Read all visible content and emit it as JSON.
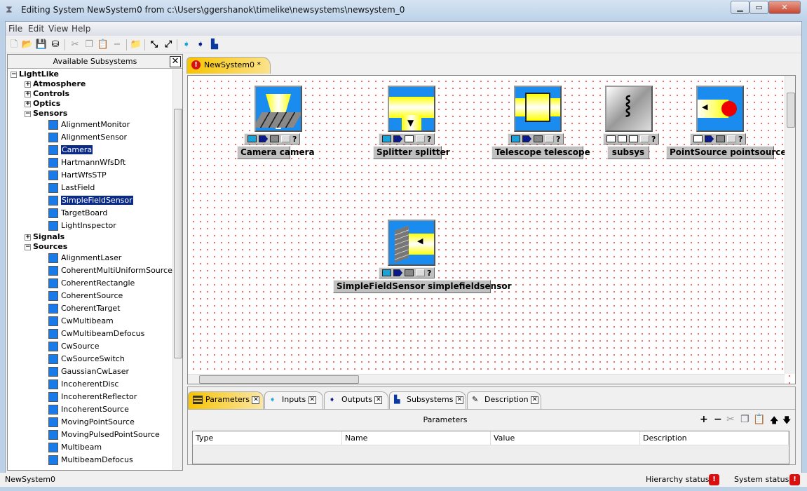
{
  "window": {
    "title": "Editing System NewSystem0 from c:\\Users\\ggershanok\\timelike\\newsystems\\newsystem_0",
    "minimize": "▁",
    "maximize": "▭",
    "close": "✕"
  },
  "menu": [
    "File",
    "Edit",
    "View",
    "Help"
  ],
  "toolbar": [
    "new-icon",
    "open-icon",
    "save-icon",
    "save-all-icon",
    "cut-icon",
    "copy-icon",
    "paste-icon",
    "remove-icon",
    "import-icon",
    "collapse-icon",
    "expand-icon",
    "add-input-icon",
    "add-output-icon",
    "add-subsystem-icon"
  ],
  "left_panel": {
    "title": "Available Subsystems",
    "close": "✕"
  },
  "tree": [
    {
      "label": "LightLike",
      "kind": "root"
    },
    {
      "label": "Atmosphere",
      "kind": "group",
      "exp": "+"
    },
    {
      "label": "Controls",
      "kind": "group",
      "exp": "+"
    },
    {
      "label": "Optics",
      "kind": "group",
      "exp": "+"
    },
    {
      "label": "Sensors",
      "kind": "group",
      "exp": "−"
    },
    {
      "label": "AlignmentMonitor",
      "kind": "leaf"
    },
    {
      "label": "AlignmentSensor",
      "kind": "leaf"
    },
    {
      "label": "Camera",
      "kind": "leaf",
      "selected": true
    },
    {
      "label": "HartmannWfsDft",
      "kind": "leaf"
    },
    {
      "label": "HartWfsSTP",
      "kind": "leaf"
    },
    {
      "label": "LastField",
      "kind": "leaf"
    },
    {
      "label": "SimpleFieldSensor",
      "kind": "leaf",
      "selected": true
    },
    {
      "label": "TargetBoard",
      "kind": "leaf"
    },
    {
      "label": "LightInspector",
      "kind": "leaf"
    },
    {
      "label": "Signals",
      "kind": "group",
      "exp": "+"
    },
    {
      "label": "Sources",
      "kind": "group",
      "exp": "−"
    },
    {
      "label": "AlignmentLaser",
      "kind": "leaf"
    },
    {
      "label": "CoherentMultiUniformSource",
      "kind": "leaf"
    },
    {
      "label": "CoherentRectangle",
      "kind": "leaf"
    },
    {
      "label": "CoherentSource",
      "kind": "leaf"
    },
    {
      "label": "CoherentTarget",
      "kind": "leaf"
    },
    {
      "label": "CwMultibeam",
      "kind": "leaf"
    },
    {
      "label": "CwMultibeamDefocus",
      "kind": "leaf"
    },
    {
      "label": "CwSource",
      "kind": "leaf"
    },
    {
      "label": "CwSourceSwitch",
      "kind": "leaf"
    },
    {
      "label": "GaussianCwLaser",
      "kind": "leaf"
    },
    {
      "label": "IncoherentDisc",
      "kind": "leaf"
    },
    {
      "label": "IncoherentReflector",
      "kind": "leaf"
    },
    {
      "label": "IncoherentSource",
      "kind": "leaf"
    },
    {
      "label": "MovingPointSource",
      "kind": "leaf"
    },
    {
      "label": "MovingPulsedPointSource",
      "kind": "leaf"
    },
    {
      "label": "Multibeam",
      "kind": "leaf"
    },
    {
      "label": "MultibeamDefocus",
      "kind": "leaf"
    }
  ],
  "editor_tab": {
    "label": "NewSystem0 *",
    "status_icon": "error-icon"
  },
  "blocks": [
    {
      "label": "Camera camera",
      "icon": "camera-icon",
      "ports": [
        "in",
        "out",
        "grey",
        "light"
      ]
    },
    {
      "label": "Splitter splitter",
      "icon": "splitter-icon",
      "ports": [
        "in",
        "out",
        "white",
        "light"
      ]
    },
    {
      "label": "Telescope telescope",
      "icon": "telescope-icon",
      "ports": [
        "in",
        "out",
        "grey",
        "light"
      ]
    },
    {
      "label": "subsys",
      "icon": "subsystem-icon",
      "ports": [
        "in-outline",
        "out-outline",
        "white",
        "light"
      ]
    },
    {
      "label": "PointSource pointsource",
      "icon": "point-source-icon",
      "ports": [
        "in-outline",
        "out",
        "grey",
        "light"
      ]
    },
    {
      "label": "SimpleFieldSensor simplefieldsensor",
      "icon": "simple-field-sensor-icon",
      "ports": [
        "in",
        "out",
        "grey",
        "light"
      ]
    }
  ],
  "help_glyph": "?",
  "bottom_tabs": [
    {
      "label": "Parameters",
      "active": true
    },
    {
      "label": "Inputs"
    },
    {
      "label": "Outputs"
    },
    {
      "label": "Subsystems"
    },
    {
      "label": "Description"
    }
  ],
  "parameters": {
    "title": "Parameters",
    "actions": [
      "+",
      "−",
      "cut-icon",
      "copy-icon",
      "paste-icon",
      "move-up-icon",
      "move-down-icon"
    ],
    "columns": [
      "Type",
      "Name",
      "Value",
      "Description"
    ],
    "rows": []
  },
  "status": {
    "left": "NewSystem0",
    "hierarchy_label": "Hierarchy status:",
    "system_label": "System status:",
    "error_glyph": "!"
  },
  "colors": {
    "input_port": "#1aa3d8",
    "output_port": "#0a1a8a",
    "canvas_dot": "#ff0000",
    "active_tab": "#f7c400",
    "error": "#d81010"
  }
}
